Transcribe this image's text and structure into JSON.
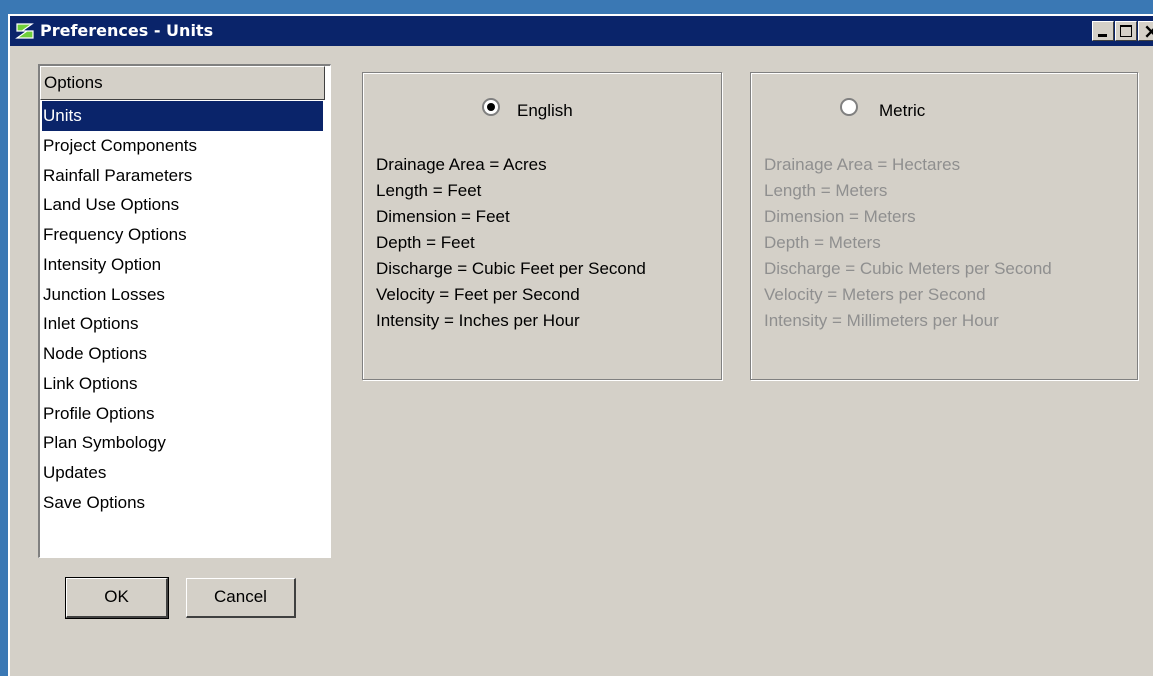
{
  "window": {
    "title": "Preferences - Units"
  },
  "options_list": {
    "header": "Options",
    "selected_index": 0,
    "items": [
      "Units",
      "Project Components",
      "Rainfall Parameters",
      "Land Use Options",
      "Frequency Options",
      "Intensity Option",
      "Junction Losses",
      "Inlet Options",
      "Node Options",
      "Link Options",
      "Profile Options",
      "Plan Symbology",
      "Updates",
      "Save Options"
    ]
  },
  "buttons": {
    "ok": "OK",
    "cancel": "Cancel"
  },
  "english": {
    "label": "English",
    "selected": true,
    "lines": [
      "Drainage Area = Acres",
      "Length = Feet",
      "Dimension = Feet",
      "Depth = Feet",
      "Discharge = Cubic Feet per Second",
      "Velocity = Feet per Second",
      "Intensity = Inches per Hour"
    ]
  },
  "metric": {
    "label": "Metric",
    "selected": false,
    "lines": [
      "Drainage Area = Hectares",
      "Length = Meters",
      "Dimension = Meters",
      "Depth = Meters",
      "Discharge = Cubic Meters per Second",
      "Velocity = Meters per Second",
      "Intensity = Millimeters per Hour"
    ]
  },
  "colors": {
    "desktop": "#3a78b4",
    "titlebar": "#0a246a",
    "selection": "#0a246a",
    "dialog": "#d4d0c8",
    "disabled_text": "#8f8f8f"
  }
}
